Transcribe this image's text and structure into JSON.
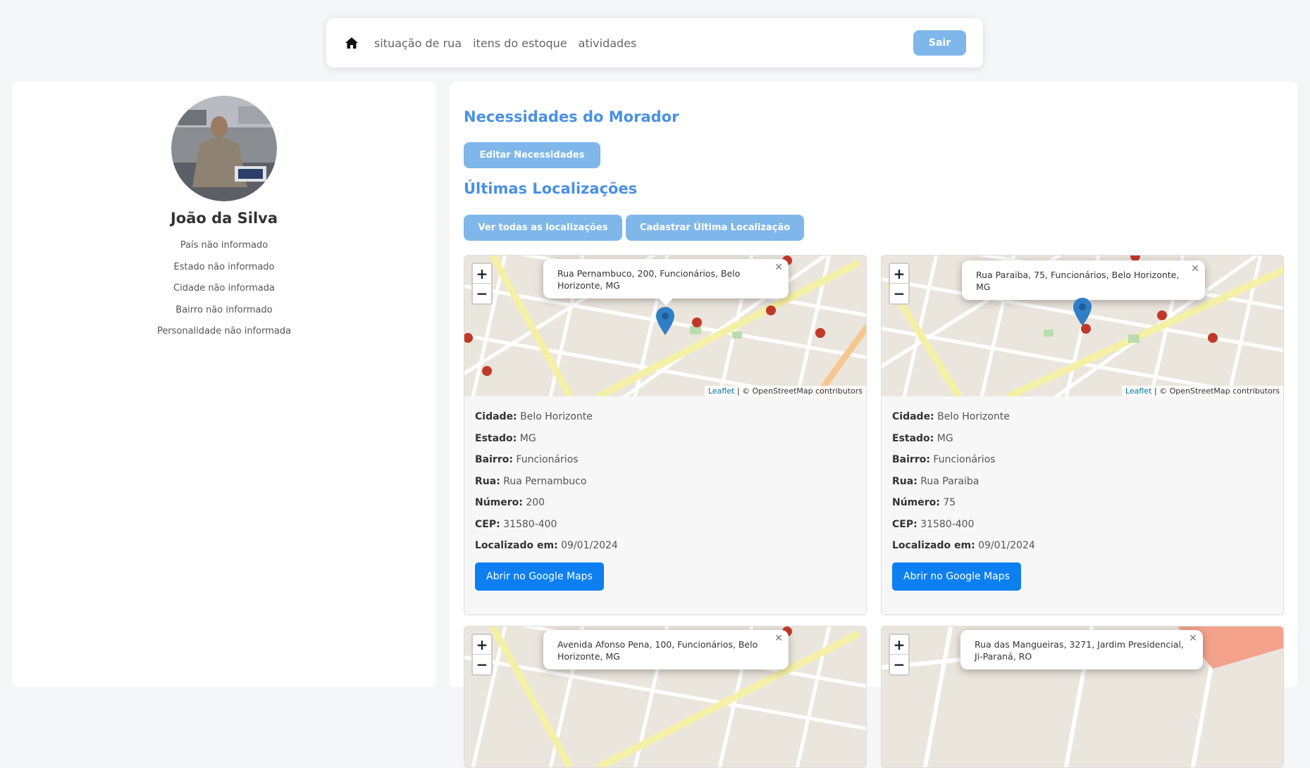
{
  "nav": {
    "links": [
      "situação de rua",
      "itens do estoque",
      "atividades"
    ],
    "logout": "Sair"
  },
  "profile": {
    "name": "João da Silva",
    "info": [
      "País não informado",
      "Estado não informado",
      "Cidade não informada",
      "Bairro não informado",
      "Personalidade não informada"
    ]
  },
  "main": {
    "needs_title": "Necessidades do Morador",
    "edit_needs": "Editar Necessidades",
    "locations_title": "Últimas Localizações",
    "see_all": "Ver todas as localizações",
    "register_last": "Cadastrar Última Localização"
  },
  "labels": {
    "city": "Cidade:",
    "state": "Estado:",
    "district": "Bairro:",
    "street": "Rua:",
    "number": "Número:",
    "cep": "CEP:",
    "located_at": "Localizado em:",
    "open_maps": "Abrir no Google Maps",
    "attrib_leaflet": "Leaflet",
    "attrib_rest": "| © OpenStreetMap contributors"
  },
  "locations": [
    {
      "popup": "Rua Pernambuco, 200, Funcionários, Belo Horizonte, MG",
      "city": "Belo Horizonte",
      "state": "MG",
      "district": "Funcionários",
      "street": "Rua Pernambuco",
      "number": "200",
      "cep": "31580-400",
      "date": "09/01/2024"
    },
    {
      "popup": "Rua Paraiba, 75, Funcionários, Belo Horizonte, MG",
      "city": "Belo Horizonte",
      "state": "MG",
      "district": "Funcionários",
      "street": "Rua Paraiba",
      "number": "75",
      "cep": "31580-400",
      "date": "09/01/2024"
    },
    {
      "popup": "Avenida Afonso Pena, 100, Funcionários, Belo Horizonte, MG"
    },
    {
      "popup": "Rua das Mangueiras, 3271, Jardim Presidencial, Ji-Paraná, RO"
    }
  ]
}
